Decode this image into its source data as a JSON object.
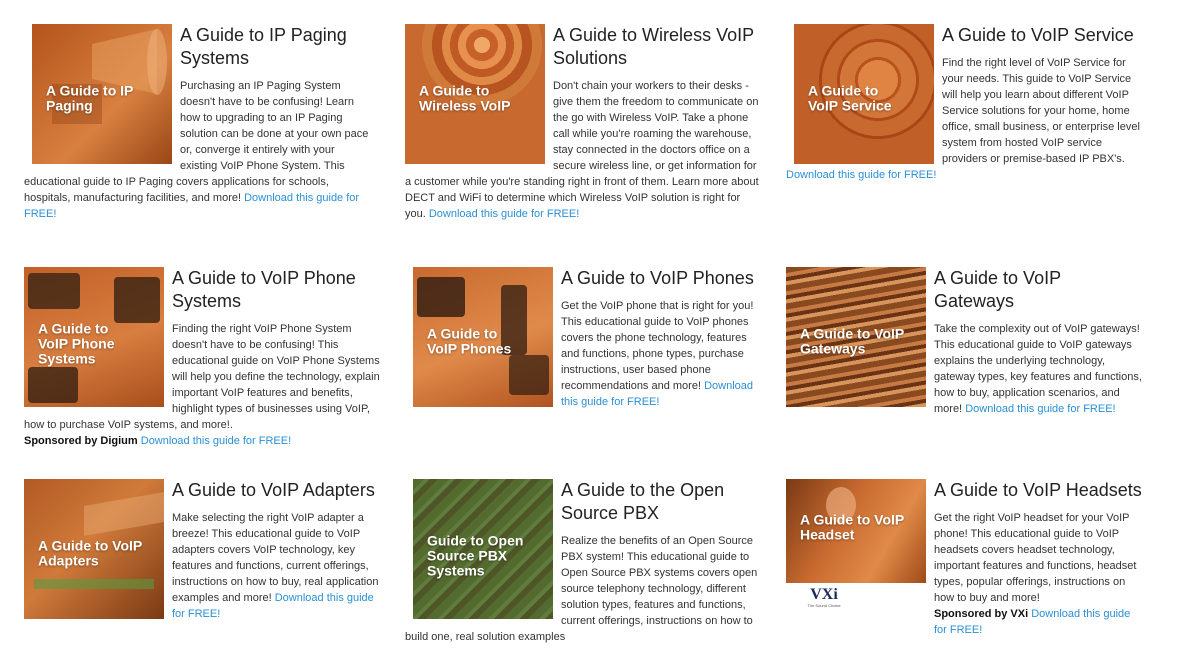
{
  "colors": {
    "link": "#2a8fd6",
    "thumb_orange": "#c8682a"
  },
  "cards": [
    {
      "title": "A Guide to IP Paging Systems",
      "thumb_label": "A Guide to IP Paging",
      "desc": "Purchasing an IP Paging System doesn't have to be confusing! Learn how to upgrading to an IP Paging solution can be done at your own pace or, converge it entirely with your existing VoIP Phone System. This educational guide to IP Paging covers applications for schools, hospitals, manufacturing facilities, and more! ",
      "link": "Download this guide for FREE!"
    },
    {
      "title": "A Guide to Wireless VoIP Solutions",
      "thumb_label": "A Guide to Wireless VoIP",
      "desc": "Don't chain your workers to their desks - give them the freedom to communicate on the go with Wireless VoIP. Take a phone call while you're roaming the warehouse, stay connected in the doctors office on a secure wireless line, or get information for a customer while you're standing right in front of them. Learn more about DECT and WiFi to determine which Wireless VoIP solution is right for you. ",
      "link": "Download this guide for FREE!"
    },
    {
      "title": "A Guide to VoIP Service",
      "thumb_label": "A Guide to VoIP Service",
      "desc": "Find the right level of VoIP Service for your needs. This guide to VoIP Service will help you learn about different VoIP Service solutions for your home, home office, small business, or enterprise level system from hosted VoIP service providers or premise-based IP PBX's. ",
      "link": "Download this guide for FREE!"
    },
    {
      "title": "A Guide to VoIP Phone Systems",
      "thumb_label": "A Guide to VoIP Phone Systems",
      "desc": "Finding the right VoIP Phone System doesn't have to be confusing! This educational guide on VoIP Phone Systems will help you define the technology, explain important VoIP features and benefits, highlight types of businesses using VoIP, how to purchase VoIP systems, and more!.",
      "sponsor": "Sponsored by Digium",
      "link": "Download this guide for FREE!"
    },
    {
      "title": "A Guide to VoIP Phones",
      "thumb_label": "A Guide to VoIP Phones",
      "desc": "Get the VoIP phone that is right for you! This educational guide to VoIP phones covers the phone technology, features and functions, phone types, purchase instructions, user based phone recommendations and more! ",
      "link": "Download this guide for FREE!"
    },
    {
      "title": "A Guide to VoIP Gateways",
      "thumb_label": "A Guide to VoIP Gateways",
      "desc": "Take the complexity out of VoIP gateways! This educational guide to VoIP gateways explains the underlying technology, gateway types, key features and functions, how to buy, application scenarios, and more! ",
      "link": "Download this guide for FREE!"
    },
    {
      "title": "A Guide to VoIP Adapters",
      "thumb_label": "A Guide to VoIP Adapters",
      "desc": "Make selecting the right VoIP adapter a breeze! This educational guide to VoIP adapters covers VoIP technology, key features and functions, current offerings, instructions on how to buy, real application examples and more! ",
      "link": "Download this guide for FREE!"
    },
    {
      "title": "A Guide to the Open Source PBX",
      "thumb_label": "Guide to Open Source PBX Systems",
      "desc": "Realize the benefits of an Open Source PBX system! This educational guide to Open Source PBX systems covers open source telephony technology, different solution types, features and functions, current offerings, instructions on how to build one, real solution examples"
    },
    {
      "title": "A Guide to VoIP Headsets",
      "thumb_label": "A Guide to VoIP Headset",
      "desc": "Get the right VoIP headset for your VoIP phone! This educational guide to VoIP headsets covers headset technology, important features and functions, headset types, popular offerings, instructions on how to buy and more! ",
      "sponsor": "Sponsored by VXi",
      "link": "Download this guide for FREE!",
      "logo_text": "VXi",
      "logo_sub": "The Sound Choice"
    }
  ]
}
